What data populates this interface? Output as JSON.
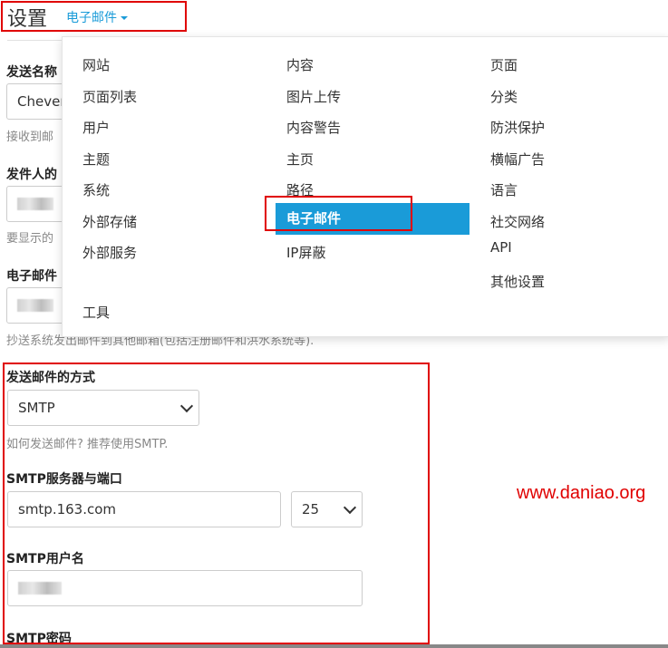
{
  "header": {
    "title": "设置",
    "section": "电子邮件"
  },
  "fields": {
    "sender_name": {
      "label": "发送名称",
      "value": "Chever",
      "hint": "接收到邮"
    },
    "sender_email": {
      "label": "发件人的",
      "hint": "要显示的"
    },
    "bcc": {
      "label": "电子邮件",
      "hint": "抄送系统发出邮件到其他邮箱(包括注册邮件和洪水系统等)."
    },
    "send_method": {
      "label": "发送邮件的方式",
      "value": "SMTP",
      "hint": "如何发送邮件? 推荐使用SMTP."
    },
    "smtp_server": {
      "label": "SMTP服务器与端口",
      "host": "smtp.163.com",
      "port": "25"
    },
    "smtp_user": {
      "label": "SMTP用户名"
    },
    "smtp_password": {
      "label": "SMTP密码"
    }
  },
  "menu": {
    "col1": [
      "网站",
      "页面列表",
      "用户",
      "主题",
      "系统",
      "外部存储",
      "外部服务",
      "工具"
    ],
    "col2": [
      "内容",
      "图片上传",
      "内容警告",
      "主页",
      "路径",
      "电子邮件",
      "IP屏蔽"
    ],
    "col3": [
      "页面",
      "分类",
      "防洪保护",
      "横幅广告",
      "语言",
      "社交网络",
      "API",
      "其他设置"
    ],
    "active": "电子邮件"
  },
  "watermark": "www.daniao.org",
  "colors": {
    "accent": "#1a9bd8",
    "annotation": "#e00000"
  }
}
